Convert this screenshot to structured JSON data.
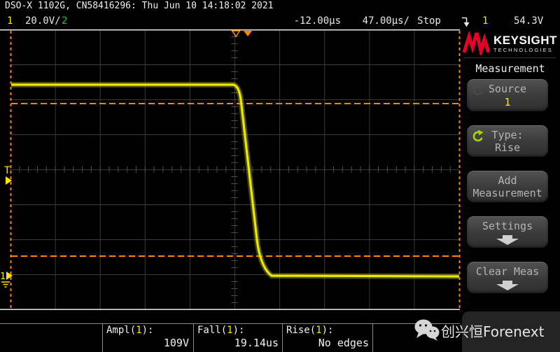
{
  "colors": {
    "ch1_yellow": "#ffe600",
    "ch2_green": "#18c832",
    "cursor_orange": "#ff8700",
    "trace_yellow": "#ece800",
    "brand_red": "#e90029"
  },
  "header": {
    "title": "DSO-X 1102G, CN58416296: Thu Jun 10 14:18:02 2021"
  },
  "status_bar": {
    "ch1_label": "1",
    "ch1_scale": "20.0V/",
    "ch2_label": "2",
    "delay": "-12.00µs",
    "timebase": "47.00µs/",
    "run_state": "Stop",
    "trigger_slope_icon": "falling-edge-trigger-icon",
    "trigger_source": "1",
    "trigger_level": "54.3V"
  },
  "scope": {
    "trigger_level_marker": "T",
    "ground_channel_marker": "1",
    "time_ref_marker_icon": "hollow-down-triangle-icon",
    "trigger_position_marker_icon": "solid-down-triangle-icon"
  },
  "sidebar": {
    "brand": "KEYSIGHT",
    "brand_sub": "TECHNOLOGIES",
    "brand_icon": "keysight-spark-icon",
    "menu_title": "Measurement",
    "source_button": {
      "label": "Source",
      "value": "1",
      "icon": "rotate-knob-icon"
    },
    "type_button": {
      "label": "Type:",
      "value": "Rise",
      "icon": "rotate-knob-icon"
    },
    "add_button": {
      "line1": "Add",
      "line2": "Measurement"
    },
    "settings_button": {
      "label": "Settings",
      "icon": "down-arrow-icon"
    },
    "clear_button": {
      "label": "Clear Meas",
      "icon": "down-arrow-icon"
    }
  },
  "measurements": [
    {
      "label": "Ampl(",
      "channel": "1",
      "label_end": "):",
      "value": "109V"
    },
    {
      "label": "Fall(",
      "channel": "1",
      "label_end": "):",
      "value": "19.14us"
    },
    {
      "label": "Rise(",
      "channel": "1",
      "label_end": "):",
      "value": "No edges"
    }
  ],
  "watermark": {
    "icon": "wechat-icon",
    "text": "创兴恒Forenext"
  }
}
